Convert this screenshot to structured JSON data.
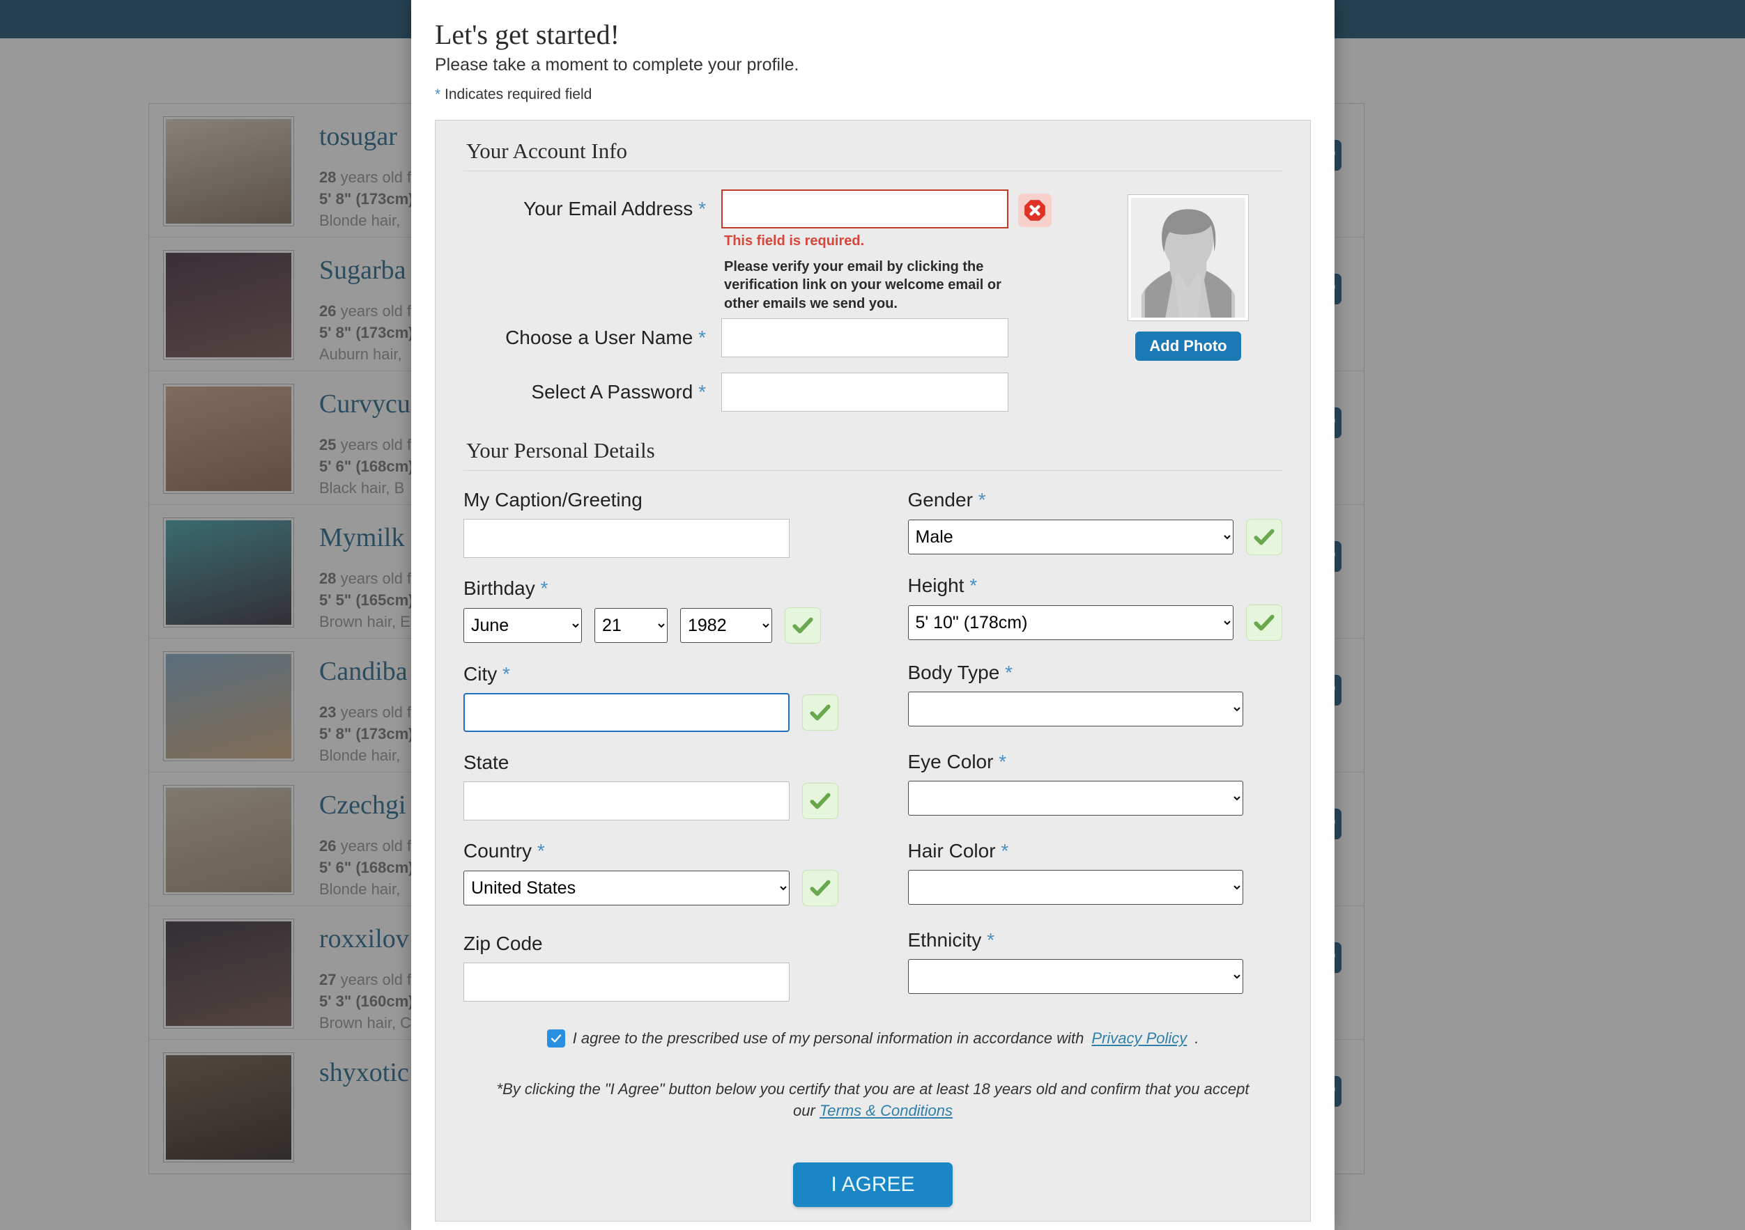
{
  "background": {
    "profiles": [
      {
        "name": "tosugar",
        "age": "28",
        "age_suffix": "years old f",
        "height": "5' 8\" (173cm)",
        "hair": "Blonde hair,",
        "thumb_top": "#d8cdbc",
        "thumb_bottom": "#7c6a58"
      },
      {
        "name": "Sugarba",
        "age": "26",
        "age_suffix": "years old f",
        "height": "5' 8\" (173cm)",
        "hair": "Auburn hair,",
        "thumb_top": "#3b2236",
        "thumb_bottom": "#6d4a45"
      },
      {
        "name": "Curvycu",
        "age": "25",
        "age_suffix": "years old f",
        "height": "5' 6\" (168cm)",
        "hair": "Black hair, B",
        "thumb_top": "#c8a183",
        "thumb_bottom": "#8d5f45"
      },
      {
        "name": "Mymilk",
        "age": "28",
        "age_suffix": "years old f",
        "height": "5' 5\" (165cm)",
        "hair": "Brown hair, E",
        "thumb_top": "#3a9fa8",
        "thumb_bottom": "#2a2430"
      },
      {
        "name": "Candiba",
        "age": "23",
        "age_suffix": "years old f",
        "height": "5' 8\" (173cm)",
        "hair": "Blonde hair,",
        "thumb_top": "#7ea6c4",
        "thumb_bottom": "#c9a070"
      },
      {
        "name": "Czechgi",
        "age": "26",
        "age_suffix": "years old f",
        "height": "5' 6\" (168cm)",
        "hair": "Blonde hair,",
        "thumb_top": "#cbbda6",
        "thumb_bottom": "#9a8468"
      },
      {
        "name": "roxxilov",
        "age": "27",
        "age_suffix": "years old f",
        "height": "5' 3\" (160cm)",
        "hair": "Brown hair, C",
        "thumb_top": "#2b2430",
        "thumb_bottom": "#6b4b44"
      },
      {
        "name": "shyxotic",
        "age": "",
        "age_suffix": "",
        "height": "",
        "hair": "",
        "thumb_top": "#6a5240",
        "thumb_bottom": "#241c16"
      }
    ],
    "gift_icon": "gift-icon"
  },
  "modal": {
    "title": "Let's get started!",
    "subtitle": "Please take a moment to complete your profile.",
    "required_note_star": "*",
    "required_note": " Indicates required field",
    "account_section_title": "Your Account Info",
    "personal_section_title": "Your Personal Details",
    "account": {
      "email_label": "Your Email Address",
      "email_value": "",
      "email_error": "This field is required.",
      "email_verify_note": "Please verify your email by clicking the verification link on your welcome email or other emails we send you.",
      "email_error_icon": "error-x-icon",
      "username_label": "Choose a User Name",
      "username_value": "",
      "password_label": "Select A Password",
      "password_value": ""
    },
    "photo": {
      "avatar_icon": "avatar-placeholder-icon",
      "add_photo_label": "Add Photo"
    },
    "personal": {
      "caption_label": "My Caption/Greeting",
      "caption_value": "",
      "birthday_label": "Birthday",
      "birthday_month": "June",
      "birthday_day": "21",
      "birthday_year": "1982",
      "city_label": "City",
      "city_value": "",
      "state_label": "State",
      "state_value": "",
      "country_label": "Country",
      "country_value": "United States",
      "zip_label": "Zip Code",
      "zip_value": "",
      "gender_label": "Gender",
      "gender_value": "Male",
      "height_label": "Height",
      "height_value": "5' 10\" (178cm)",
      "body_type_label": "Body Type",
      "body_type_value": "",
      "eye_color_label": "Eye Color",
      "eye_color_value": "",
      "hair_color_label": "Hair Color",
      "hair_color_value": "",
      "ethnicity_label": "Ethnicity",
      "ethnicity_value": ""
    },
    "consent": {
      "checked": true,
      "text_before": "I agree to the prescribed use of my personal information in accordance with ",
      "privacy_link": "Privacy Policy",
      "text_after": ".",
      "terms_before": "*By clicking the \"I Agree\" button below you certify that you are at least 18 years old and confirm that you accept our ",
      "terms_link": "Terms & Conditions"
    },
    "submit_label": "I AGREE"
  },
  "colors": {
    "header_navy": "#0e4566",
    "accent_blue": "#1b86c6",
    "link_blue": "#2f7fa8",
    "error_red": "#d9453a",
    "success_green": "#6aa84f",
    "required_star": "#4a90c4",
    "panel_grey": "#ebebeb"
  }
}
